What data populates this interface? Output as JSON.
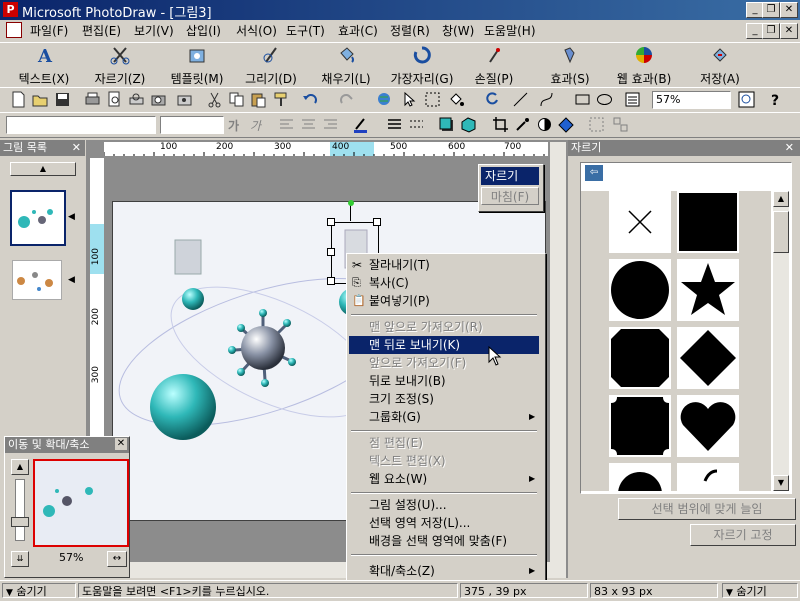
{
  "window": {
    "app": "Microsoft PhotoDraw",
    "doc": "[그림3]",
    "title": "Microsoft PhotoDraw - [그림3]"
  },
  "menubar": [
    "파일(F)",
    "편집(E)",
    "보기(V)",
    "삽입(I)",
    "서식(O)",
    "도구(T)",
    "효과(C)",
    "정렬(R)",
    "창(W)",
    "도움말(H)"
  ],
  "bigtoolbar": [
    {
      "label": "텍스트(X)",
      "icon": "text-icon"
    },
    {
      "label": "자르기(Z)",
      "icon": "scissors-icon"
    },
    {
      "label": "템플릿(M)",
      "icon": "template-icon"
    },
    {
      "label": "그리기(D)",
      "icon": "draw-icon"
    },
    {
      "label": "채우기(L)",
      "icon": "fill-icon"
    },
    {
      "label": "가장자리(G)",
      "icon": "edge-icon"
    },
    {
      "label": "손질(P)",
      "icon": "touchup-icon"
    },
    {
      "label": "효과(S)",
      "icon": "effects-icon"
    },
    {
      "label": "웹 효과(B)",
      "icon": "web-effects-icon"
    },
    {
      "label": "저장(A)",
      "icon": "save-icon"
    }
  ],
  "zoom": "57%",
  "left_panel": {
    "title": "그림 목록"
  },
  "navigator": {
    "title": "이동 및 확대/축소",
    "zoom": "57%"
  },
  "rulers": {
    "h": [
      "100",
      "200",
      "300",
      "400",
      "500",
      "600",
      "700"
    ],
    "v": [
      "100",
      "200",
      "300"
    ]
  },
  "cut_popup": {
    "items": [
      "자르기",
      "마침(F)"
    ]
  },
  "context_menu": {
    "items": [
      {
        "label": "잘라내기(T)",
        "state": "normal"
      },
      {
        "label": "복사(C)",
        "state": "normal"
      },
      {
        "label": "붙여넣기(P)",
        "state": "normal"
      },
      {
        "label": "맨 앞으로 가져오기(R)",
        "state": "disabled"
      },
      {
        "label": "맨 뒤로 보내기(K)",
        "state": "selected"
      },
      {
        "label": "앞으로 가져오기(F)",
        "state": "disabled"
      },
      {
        "label": "뒤로 보내기(B)",
        "state": "normal"
      },
      {
        "label": "크기 조정(S)",
        "state": "normal"
      },
      {
        "label": "그룹화(G)",
        "state": "normal"
      },
      {
        "label": "점 편집(E)",
        "state": "disabled"
      },
      {
        "label": "텍스트 편집(X)",
        "state": "disabled"
      },
      {
        "label": "웹 요소(W)",
        "state": "normal"
      },
      {
        "label": "그림 설정(U)...",
        "state": "normal"
      },
      {
        "label": "선택 영역 저장(L)...",
        "state": "normal"
      },
      {
        "label": "배경을 선택 영역에 맞춤(F)",
        "state": "normal"
      },
      {
        "label": "확대/축소(Z)",
        "state": "normal"
      }
    ]
  },
  "right_panel": {
    "title": "자르기",
    "btn_fit": "선택 범위에 맞게 늘임",
    "btn_lock": "자르기 고정",
    "shapes": [
      "x-shape-icon",
      "square-icon",
      "circle-icon",
      "star-icon",
      "octagon-icon",
      "diamond-icon",
      "stamp-icon",
      "heart-icon"
    ]
  },
  "status": {
    "hide_left": "숨기기",
    "help": "도움말을 보려면 <F1>키를 누르십시오.",
    "pos": "375 , 39 px",
    "size": "83 x 93 px",
    "hide_right": "숨기기"
  },
  "colors": {
    "title": "#0a246a",
    "select": "#0a246a",
    "accent": "#2fb8b8"
  }
}
